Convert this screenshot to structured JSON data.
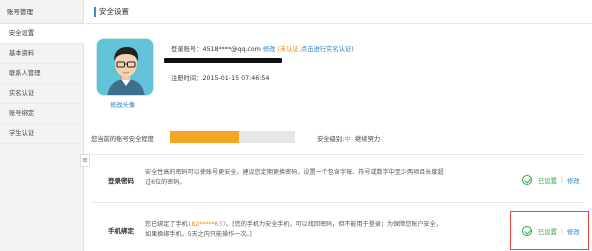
{
  "sidebar": {
    "heading": "账号管理",
    "items": [
      {
        "label": "安全设置"
      },
      {
        "label": "基本资料"
      },
      {
        "label": "联系人管理"
      },
      {
        "label": "实名认证"
      },
      {
        "label": "账号绑定"
      },
      {
        "label": "学生认证"
      }
    ],
    "active_index": 0
  },
  "header": {
    "title": "安全设置"
  },
  "account": {
    "avatar_link": "修改头像",
    "login_label": "登录账号：",
    "login_value": "4518****@qq.com",
    "edit_link": "修改",
    "verify_status": "(未认证,",
    "verify_link": "点击进行实名认证)",
    "register_label": "注册时间：",
    "register_value": "2015-01-15 07:46:54"
  },
  "security_level": {
    "label": "您当前的账号安全程度",
    "progress_fraction": 0.55,
    "level_label": "安全级别:",
    "level_value": "中",
    "level_hint": "继续努力"
  },
  "items": [
    {
      "title": "登录密码",
      "description": "安全性高的密码可以使账号更安全。建议您定期更换密码，设置一个包含字母、符号或数字中至少两项且长度超过6位的密码。",
      "status": "已设置",
      "action": "修改"
    },
    {
      "title": "手机绑定",
      "description_pre": "您已绑定了手机",
      "phone": "182*****637",
      "description_post": "。[您的手机为安全手机，可以找回密码，但不能用于登录；为保障您账户安全，如果换绑手机，5天之内只能操作一次。]",
      "status": "已设置",
      "action": "修改"
    }
  ],
  "colors": {
    "accent_blue": "#2f7fc1",
    "success_green": "#2eaa3a",
    "warning_orange": "#f08c00",
    "progress_fill": "#f4a620",
    "highlight_red": "#e8453c"
  }
}
